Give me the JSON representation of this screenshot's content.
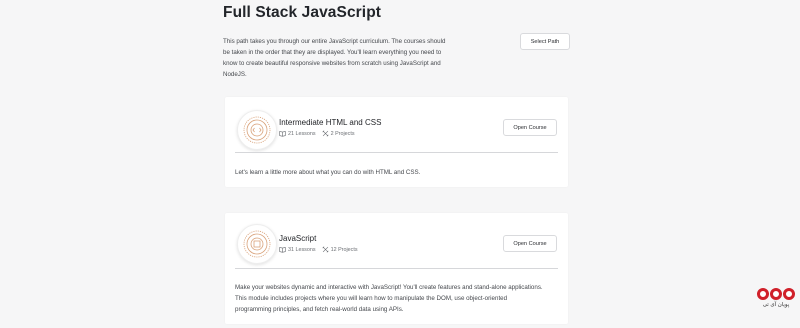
{
  "page": {
    "title": "Full Stack JavaScript",
    "description": "This path takes you through our entire JavaScript curriculum. The courses should be taken in the order that they are displayed. You'll learn everything you need to know to create beautiful responsive websites from scratch using JavaScript and NodeJS.",
    "select_path_label": "Select Path"
  },
  "courses": [
    {
      "title": "Intermediate HTML and CSS",
      "lessons": "21 Lessons",
      "projects": "2 Projects",
      "open_label": "Open Course",
      "description": "Let's learn a little more about what you can do with HTML and CSS."
    },
    {
      "title": "JavaScript",
      "lessons": "31 Lessons",
      "projects": "12 Projects",
      "open_label": "Open Course",
      "description": "Make your websites dynamic and interactive with JavaScript! You'll create features and stand-alone applications. This module includes projects where you will learn how to manipulate the DOM, use object-oriented programming principles, and fetch real-world data using APIs."
    }
  ],
  "brand": {
    "text": "پویان آی تی"
  },
  "colors": {
    "accent": "#d0202a",
    "badge_line": "#d9a27a"
  },
  "icons": {
    "lessons": "book-icon",
    "projects": "tools-icon",
    "badge": "course-badge-icon"
  }
}
